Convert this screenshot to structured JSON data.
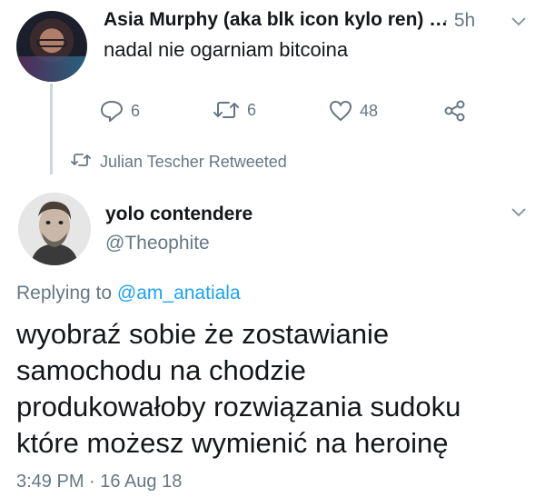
{
  "tweet1": {
    "name": "Asia Murphy (aka blk icon kylo ren)",
    "ellipsis": "…",
    "time": "· 5h",
    "text": "nadal nie ogarniam bitcoina",
    "replies": "6",
    "retweets": "6",
    "likes": "48"
  },
  "retweet_notice": {
    "label": "Julian Tescher Retweeted"
  },
  "tweet2": {
    "name": "yolo contendere",
    "handle": "@Theophite",
    "replying_prefix": "Replying to",
    "replying_to": "@am_anatiala",
    "lines": [
      "wyobraź sobie że zostawianie",
      "samochodu na chodzie",
      "produkowałoby rozwiązania sudoku",
      "które możesz wymienić na heroinę"
    ],
    "timestamp": "3:49 PM · 16 Aug 18"
  },
  "icons": {
    "reply": "reply-icon",
    "retweet": "retweet-icon",
    "like": "heart-icon",
    "share": "share-icon",
    "caret": "chevron-down-icon"
  },
  "colors": {
    "text": "#14171a",
    "muted": "#657786",
    "link": "#1da1f2",
    "thread": "#ccd6dd"
  }
}
